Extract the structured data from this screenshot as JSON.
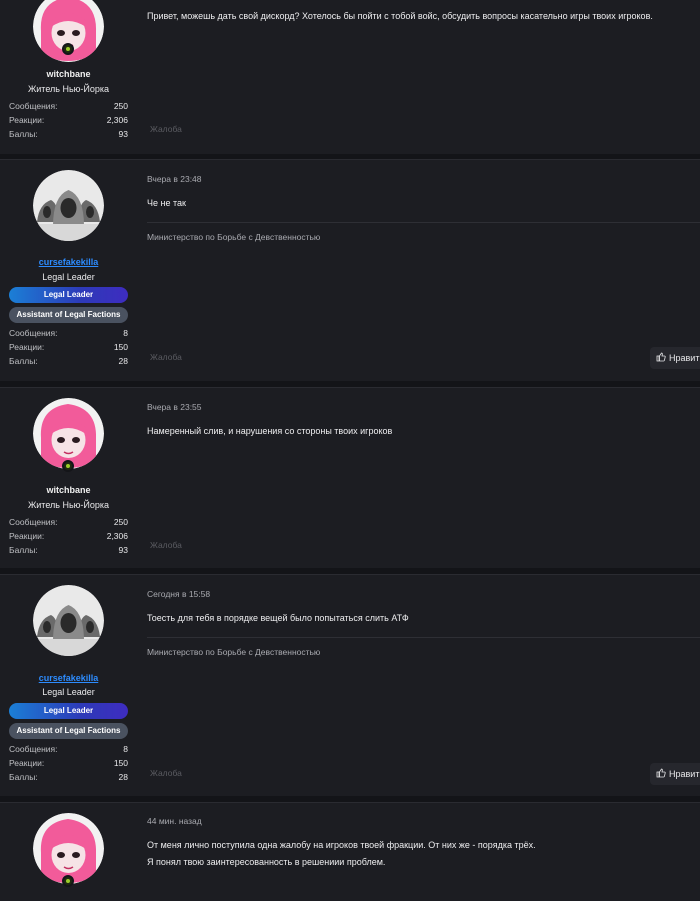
{
  "posts": [
    {
      "username": "witchbane",
      "user_title": "Житель Нью-Йорка",
      "stats": [
        {
          "label": "Сообщения:",
          "value": "250"
        },
        {
          "label": "Реакции:",
          "value": "2,306"
        },
        {
          "label": "Баллы:",
          "value": "93"
        }
      ],
      "text": "Привет, можешь дать свой дискорд? Хотелось бы пойти с тобой войс, обсудить вопросы касательно игры твоих игроков.",
      "report": "Жалоба"
    },
    {
      "date": "Вчера в 23:48",
      "username": "cursefakekilla",
      "user_title": "Legal Leader",
      "banner1": "Legal Leader",
      "banner2": "Assistant of Legal Factions",
      "stats": [
        {
          "label": "Сообщения:",
          "value": "8"
        },
        {
          "label": "Реакции:",
          "value": "150"
        },
        {
          "label": "Баллы:",
          "value": "28"
        }
      ],
      "text": "Че не так",
      "signature": "Министерство по Борьбе с Девственностью",
      "report": "Жалоба",
      "like": "Нравит"
    },
    {
      "date": "Вчера в 23:55",
      "username": "witchbane",
      "user_title": "Житель Нью-Йорка",
      "stats": [
        {
          "label": "Сообщения:",
          "value": "250"
        },
        {
          "label": "Реакции:",
          "value": "2,306"
        },
        {
          "label": "Баллы:",
          "value": "93"
        }
      ],
      "text": "Намеренный слив, и нарушения со стороны твоих игроков",
      "report": "Жалоба"
    },
    {
      "date": "Сегодня в 15:58",
      "username": "cursefakekilla",
      "user_title": "Legal Leader",
      "banner1": "Legal Leader",
      "banner2": "Assistant of Legal Factions",
      "stats": [
        {
          "label": "Сообщения:",
          "value": "8"
        },
        {
          "label": "Реакции:",
          "value": "150"
        },
        {
          "label": "Баллы:",
          "value": "28"
        }
      ],
      "text": "Тоесть для тебя в порядке вещей было попытаться слить АТФ",
      "signature": "Министерство по Борьбе с Девственностью",
      "report": "Жалоба",
      "like": "Нравит"
    },
    {
      "date": "44 мин. назад",
      "lines": [
        "От меня лично поступила одна жалобу на игроков твоей фракции. От них же - порядка трёх.",
        "Я понял твою заинтересованность в решениии проблем."
      ]
    }
  ],
  "icons": {
    "avatar_pink": "pink-anime-girl-avatar",
    "avatar_gray": "hooded-figures-avatar",
    "like": "thumbs-up-icon"
  },
  "colors": {
    "page_bg": "#131418",
    "post_bg": "#1c1d22",
    "username_link": "#2d8cff",
    "online_dot": "#9ccc2a"
  }
}
